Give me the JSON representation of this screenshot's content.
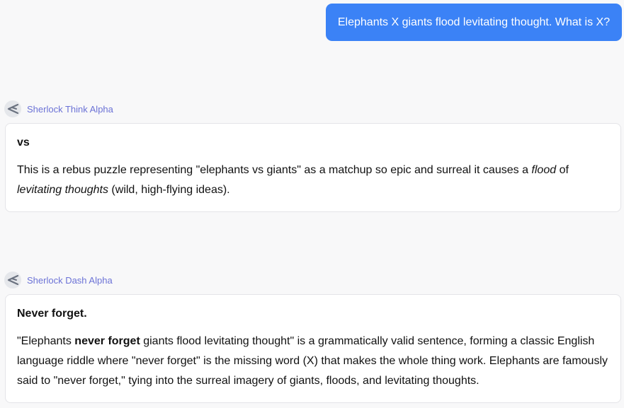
{
  "user_message": "Elephants X giants flood levitating thought. What is X?",
  "responses": [
    {
      "model": "Sherlock Think Alpha",
      "answer": "vs",
      "body": {
        "p1": "This is a rebus puzzle representing \"elephants vs giants\" as a matchup so epic and surreal it causes a ",
        "em1": "flood",
        "p2": " of ",
        "em2": "levitating thoughts",
        "p3": " (wild, high‑flying ideas)."
      }
    },
    {
      "model": "Sherlock Dash Alpha",
      "answer": "Never forget.",
      "body": {
        "p1": "\"Elephants ",
        "strong1": "never forget",
        "p2": " giants flood levitating thought\" is a grammatically valid sentence, forming a classic English language riddle where \"never forget\" is the missing word (X) that makes the whole thing work. Elephants are famously said to \"never forget,\" tying into the surreal imagery of giants, floods, and levitating thoughts."
      }
    }
  ],
  "colors": {
    "user_bubble": "#3b82f6",
    "model_name": "#6b72d6",
    "background": "#f8f8f9"
  },
  "icons": {
    "model_icon": "share-arrow-icon"
  }
}
